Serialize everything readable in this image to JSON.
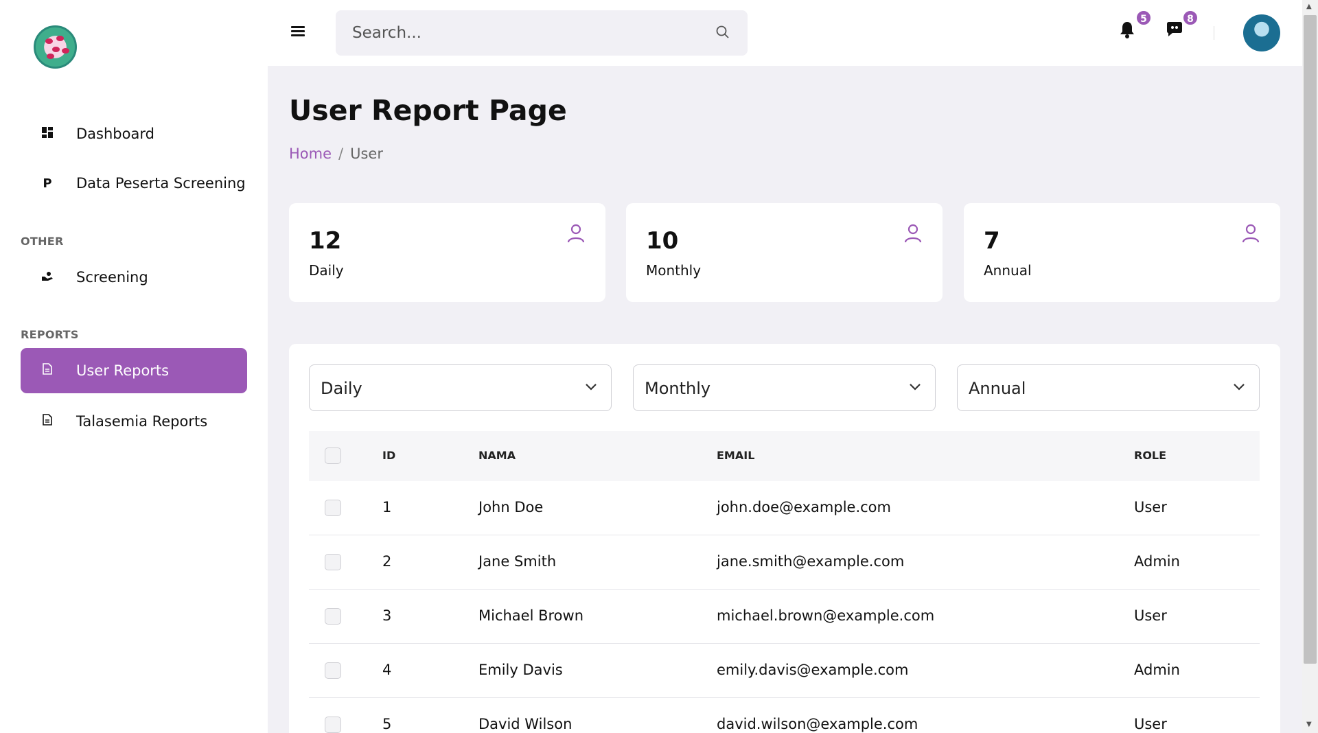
{
  "header": {
    "search_placeholder": "Search...",
    "notifications_count": "5",
    "messages_count": "8"
  },
  "sidebar": {
    "items": [
      {
        "label": "Dashboard",
        "icon": "grid-icon"
      },
      {
        "label": "Data Peserta Screening",
        "icon": "p-icon"
      },
      {
        "label": "Screening",
        "icon": "hand-icon"
      },
      {
        "label": "User Reports",
        "icon": "document-icon",
        "active": true
      },
      {
        "label": "Talasemia Reports",
        "icon": "document-icon"
      }
    ],
    "section_other": "OTHER",
    "section_reports": "REPORTS"
  },
  "main": {
    "title": "User Report Page",
    "breadcrumb": {
      "home": "Home",
      "current": "User"
    },
    "stats": [
      {
        "value": "12",
        "label": "Daily"
      },
      {
        "value": "10",
        "label": "Monthly"
      },
      {
        "value": "7",
        "label": "Annual"
      }
    ],
    "filters": [
      "Daily",
      "Monthly",
      "Annual"
    ],
    "table": {
      "headers": {
        "id": "ID",
        "name": "NAMA",
        "email": "EMAIL",
        "role": "ROLE"
      },
      "rows": [
        {
          "id": "1",
          "name": "John Doe",
          "email": "john.doe@example.com",
          "role": "User"
        },
        {
          "id": "2",
          "name": "Jane Smith",
          "email": "jane.smith@example.com",
          "role": "Admin"
        },
        {
          "id": "3",
          "name": "Michael Brown",
          "email": "michael.brown@example.com",
          "role": "User"
        },
        {
          "id": "4",
          "name": "Emily Davis",
          "email": "emily.davis@example.com",
          "role": "Admin"
        },
        {
          "id": "5",
          "name": "David Wilson",
          "email": "david.wilson@example.com",
          "role": "User"
        }
      ]
    }
  },
  "colors": {
    "accent": "#9b59b6",
    "background": "#f1f0f5"
  }
}
